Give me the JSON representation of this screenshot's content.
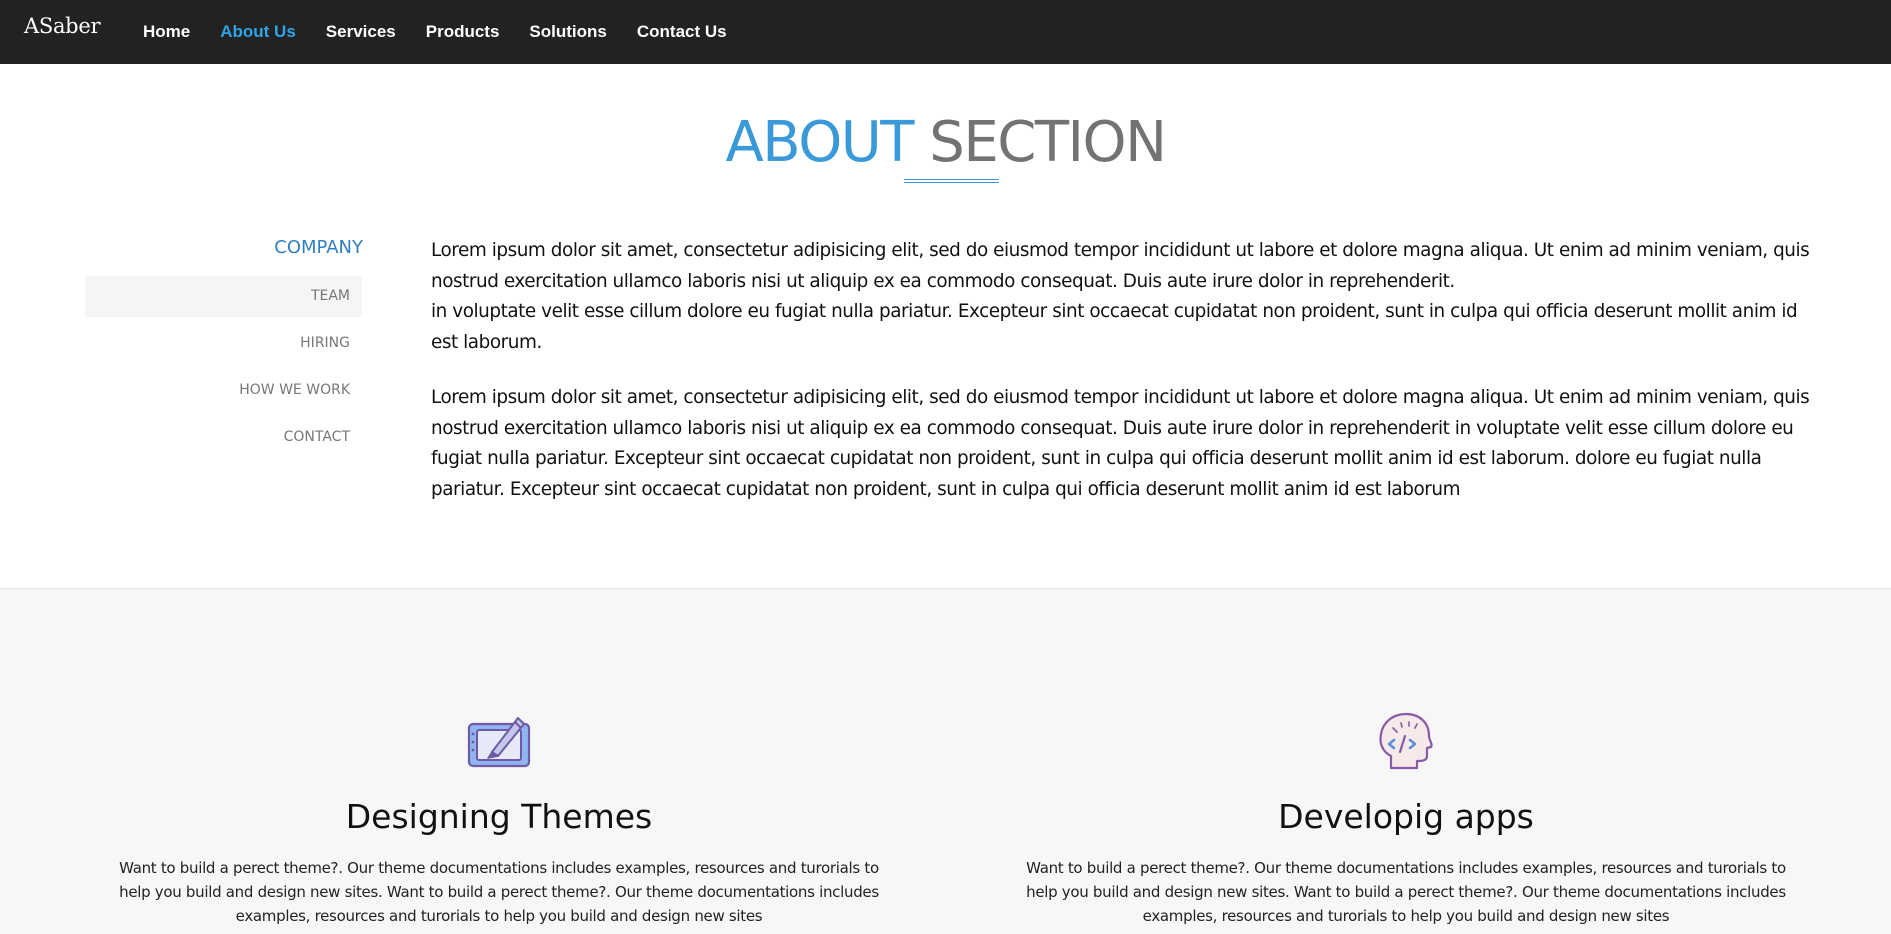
{
  "brand": "ASaber",
  "nav": {
    "items": [
      {
        "label": "Home"
      },
      {
        "label": "About Us"
      },
      {
        "label": "Services"
      },
      {
        "label": "Products"
      },
      {
        "label": "Solutions"
      },
      {
        "label": "Contact Us"
      }
    ],
    "active_index": 1,
    "active_color": "#2fa4e7"
  },
  "about": {
    "heading_part1": "ABOUT",
    "heading_part2": "SECTION",
    "accent_color": "#3a9ad9"
  },
  "sidebar": {
    "title": "COMPANY",
    "items": [
      {
        "label": "TEAM"
      },
      {
        "label": "HIRING"
      },
      {
        "label": "HOW WE WORK"
      },
      {
        "label": "CONTACT"
      }
    ]
  },
  "main": {
    "p1_line1": "Lorem ipsum dolor sit amet, consectetur adipisicing elit, sed do eiusmod tempor incididunt ut labore et dolore magna aliqua. Ut enim ad minim veniam, quis nostrud exercitation ullamco laboris nisi ut aliquip ex ea commodo consequat. Duis aute irure dolor in reprehenderit.",
    "p1_line2": "in voluptate velit esse cillum dolore eu fugiat nulla pariatur. Excepteur sint occaecat cupidatat non proident, sunt in culpa qui officia deserunt mollit anim id est laborum.",
    "p2": "Lorem ipsum dolor sit amet, consectetur adipisicing elit, sed do eiusmod tempor incididunt ut labore et dolore magna aliqua. Ut enim ad minim veniam, quis nostrud exercitation ullamco laboris nisi ut aliquip ex ea commodo consequat. Duis aute irure dolor in reprehenderit in voluptate velit esse cillum dolore eu fugiat nulla pariatur. Excepteur sint occaecat cupidatat non proident, sunt in culpa qui officia deserunt mollit anim id est laborum. dolore eu fugiat nulla pariatur. Excepteur sint occaecat cupidatat non proident, sunt in culpa qui officia deserunt mollit anim id est laborum"
  },
  "features": [
    {
      "icon": "design-tablet-icon",
      "title": "Designing Themes",
      "desc": "Want to build a perect theme?. Our theme documentations includes examples, resources and turorials to help you build and design new sites. Want to build a perect theme?. Our theme documentations includes examples, resources and turorials to help you build and design new sites"
    },
    {
      "icon": "code-head-icon",
      "title": "Developig apps",
      "desc": "Want to build a perect theme?. Our theme documentations includes examples, resources and turorials to help you build and design new sites. Want to build a perect theme?. Our theme documentations includes examples, resources and turorials to help you build and design new sites"
    }
  ]
}
